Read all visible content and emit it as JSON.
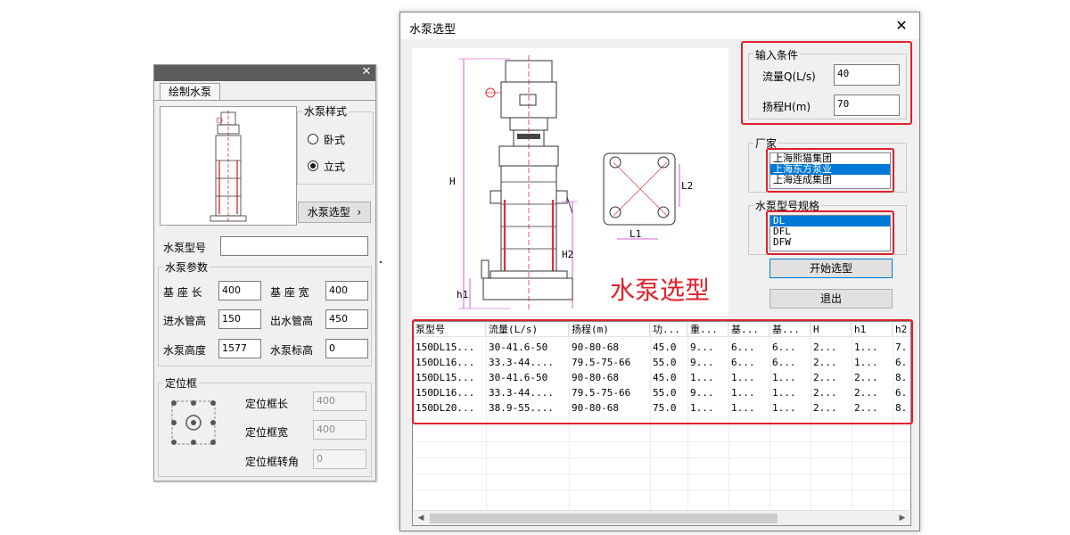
{
  "left_panel": {
    "tab": "绘制水泵",
    "style_group": {
      "title": "水泵样式",
      "options": [
        "卧式",
        "立式"
      ],
      "selected": "立式"
    },
    "select_button": "水泵选型",
    "model": {
      "label": "水泵型号",
      "value": ""
    },
    "params": {
      "title": "水泵参数",
      "rows": [
        {
          "label": "基 座 长",
          "value": "400"
        },
        {
          "label": "基 座 宽",
          "value": "400"
        },
        {
          "label": "进水管高",
          "value": "150"
        },
        {
          "label": "出水管高",
          "value": "450"
        },
        {
          "label": "水泵高度",
          "value": "1577"
        },
        {
          "label": "水泵标高",
          "value": "0"
        }
      ]
    },
    "frame": {
      "title": "定位框",
      "rows": [
        {
          "label": "定位框长",
          "value": "400"
        },
        {
          "label": "定位框宽",
          "value": "400"
        },
        {
          "label": "定位框转角",
          "value": "0"
        }
      ]
    }
  },
  "dialog": {
    "title": "水泵选型",
    "overlay_text": "水泵选型",
    "dim_labels": {
      "H": "H",
      "H2": "H2",
      "h1": "h1",
      "L1": "L1",
      "L2": "L2"
    },
    "conditions": {
      "title": "输入条件",
      "flow_label": "流量Q(L/s)",
      "flow_value": "40",
      "head_label": "扬程H(m)",
      "head_value": "70"
    },
    "manufacturer": {
      "title": "厂家",
      "items": [
        "上海熊猫集团",
        "上海东方泵业",
        "上海连成集团"
      ],
      "selected_index": 1
    },
    "spec": {
      "title": "水泵型号规格",
      "items": [
        "DL",
        "DFL",
        "DFW"
      ],
      "selected_index": 0
    },
    "start_button": "开始选型",
    "exit_button": "退出",
    "table": {
      "columns": [
        "泵型号",
        "流量(L/s)",
        "扬程(m)",
        "功...",
        "重...",
        "基...",
        "基...",
        "H",
        "h1",
        "h2"
      ],
      "rows": [
        [
          "150DL15...",
          "30-41.6-50",
          "90-80-68",
          "45.0",
          "9...",
          "6...",
          "6...",
          "2...",
          "1...",
          "7."
        ],
        [
          "150DL16...",
          "33.3-44....",
          "79.5-75-66",
          "55.0",
          "9...",
          "6...",
          "6...",
          "2...",
          "1...",
          "6."
        ],
        [
          "150DL15...",
          "30-41.6-50",
          "90-80-68",
          "45.0",
          "1...",
          "1...",
          "1...",
          "2...",
          "2...",
          "8."
        ],
        [
          "150DL16...",
          "33.3-44....",
          "79.5-75-66",
          "55.0",
          "9...",
          "1...",
          "1...",
          "2...",
          "2...",
          "6."
        ],
        [
          "150DL20...",
          "38.9-55....",
          "90-80-68",
          "75.0",
          "1...",
          "1...",
          "1...",
          "2...",
          "2...",
          "8."
        ]
      ]
    }
  }
}
